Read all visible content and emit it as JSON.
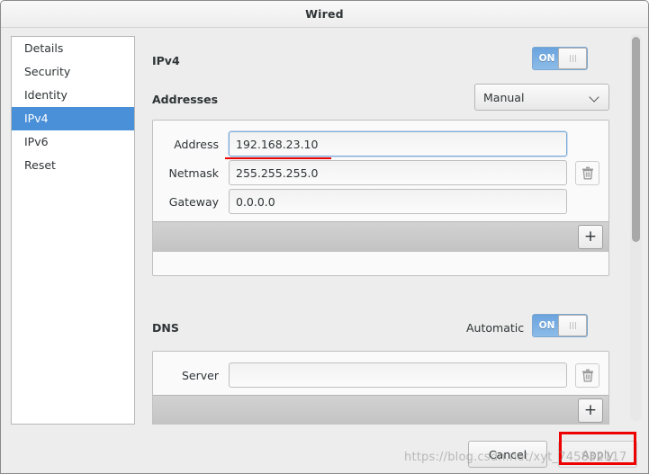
{
  "window": {
    "title": "Wired"
  },
  "sidebar": {
    "items": [
      {
        "label": "Details",
        "selected": false
      },
      {
        "label": "Security",
        "selected": false
      },
      {
        "label": "Identity",
        "selected": false
      },
      {
        "label": "IPv4",
        "selected": true
      },
      {
        "label": "IPv6",
        "selected": false
      },
      {
        "label": "Reset",
        "selected": false
      }
    ]
  },
  "ipv4": {
    "heading": "IPv4",
    "toggle_label": "ON",
    "toggle_state": "on",
    "addresses_heading": "Addresses",
    "method": "Manual",
    "rows": [
      {
        "label": "Address",
        "value": "192.168.23.10",
        "focused": true
      },
      {
        "label": "Netmask",
        "value": "255.255.255.0",
        "focused": false
      },
      {
        "label": "Gateway",
        "value": "0.0.0.0",
        "focused": false
      }
    ],
    "delete_icon": "trash-icon",
    "add_label": "+"
  },
  "dns": {
    "heading": "DNS",
    "automatic_label": "Automatic",
    "toggle_label": "ON",
    "toggle_state": "on",
    "rows": [
      {
        "label": "Server",
        "value": "",
        "focused": false
      }
    ],
    "delete_icon": "trash-icon",
    "add_label": "+"
  },
  "actions": {
    "cancel_label": "Cancel",
    "apply_label": "Apply",
    "apply_disabled": true
  },
  "watermark": {
    "text": "https://blog.csdn.net/xyt_745832117"
  },
  "colors": {
    "selection_blue": "#4a90d9",
    "toggle_blue": "#6aa3dd",
    "annotation_red": "#ee0000",
    "window_bg": "#ededed"
  }
}
